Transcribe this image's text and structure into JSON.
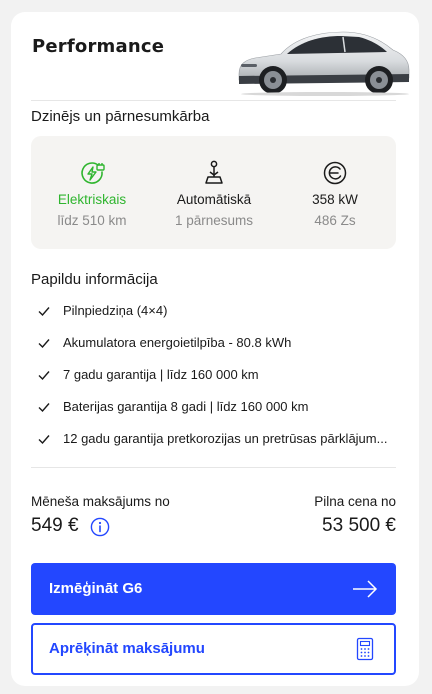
{
  "header": {
    "title": "Performance"
  },
  "engine": {
    "title": "Dzinējs un pārnesumkārba",
    "specs": [
      {
        "icon": "ev-charging-plug-icon",
        "name": "Elektriskais",
        "sub": "līdz 510 km",
        "color": "#2fb52f"
      },
      {
        "icon": "gear-shifter-icon",
        "name": "Automātiskā",
        "sub": "1 pārnesums"
      },
      {
        "icon": "engine-power-icon",
        "name": "358 kW",
        "sub": "486 Zs"
      }
    ]
  },
  "extra": {
    "title": "Papildu informācija",
    "features": [
      "Pilnpiedziņa (4×4)",
      "Akumulatora energoietilpība - 80.8 kWh",
      "7 gadu garantija | līdz 160 000 km",
      "Baterijas garantija 8 gadi | līdz 160 000 km",
      "12 gadu garantija pretkorozijas un pretrūsas pārklājum..."
    ]
  },
  "pricing": {
    "monthly_label": "Mēneša maksājums no",
    "monthly_value": "549 €",
    "full_label": "Pilna cena no",
    "full_value": "53 500 €"
  },
  "actions": {
    "primary_label": "Izmēģināt G6",
    "secondary_label": "Aprēķināt maksājumu"
  },
  "colors": {
    "accent": "#2347ff",
    "electric": "#2fb52f"
  }
}
